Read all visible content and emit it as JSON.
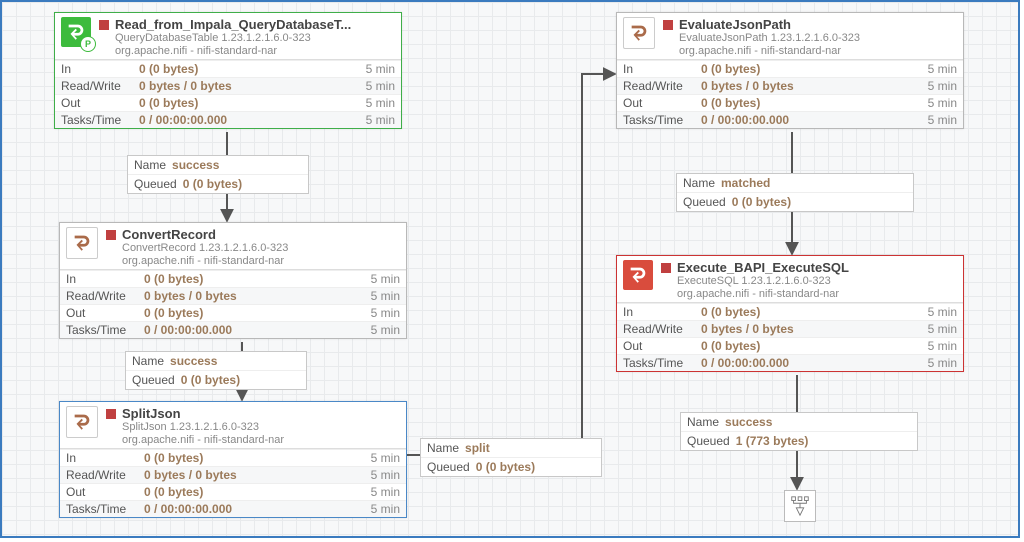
{
  "processors": {
    "read_impala": {
      "title": "Read_from_Impala_QueryDatabaseT...",
      "type_line": "QueryDatabaseTable 1.23.1.2.1.6.0-323",
      "bundle": "org.apache.nifi - nifi-standard-nar",
      "in_label": "In",
      "in_value": "0 (0 bytes)",
      "in_time": "5 min",
      "rw_label": "Read/Write",
      "rw_value": "0 bytes / 0 bytes",
      "rw_time": "5 min",
      "out_label": "Out",
      "out_value": "0 (0 bytes)",
      "out_time": "5 min",
      "tasks_label": "Tasks/Time",
      "tasks_value": "0 / 00:00:00.000",
      "tasks_time": "5 min"
    },
    "convert_record": {
      "title": "ConvertRecord",
      "type_line": "ConvertRecord 1.23.1.2.1.6.0-323",
      "bundle": "org.apache.nifi - nifi-standard-nar",
      "in_label": "In",
      "in_value": "0 (0 bytes)",
      "in_time": "5 min",
      "rw_label": "Read/Write",
      "rw_value": "0 bytes / 0 bytes",
      "rw_time": "5 min",
      "out_label": "Out",
      "out_value": "0 (0 bytes)",
      "out_time": "5 min",
      "tasks_label": "Tasks/Time",
      "tasks_value": "0 / 00:00:00.000",
      "tasks_time": "5 min"
    },
    "split_json": {
      "title": "SplitJson",
      "type_line": "SplitJson 1.23.1.2.1.6.0-323",
      "bundle": "org.apache.nifi - nifi-standard-nar",
      "in_label": "In",
      "in_value": "0 (0 bytes)",
      "in_time": "5 min",
      "rw_label": "Read/Write",
      "rw_value": "0 bytes / 0 bytes",
      "rw_time": "5 min",
      "out_label": "Out",
      "out_value": "0 (0 bytes)",
      "out_time": "5 min",
      "tasks_label": "Tasks/Time",
      "tasks_value": "0 / 00:00:00.000",
      "tasks_time": "5 min"
    },
    "eval_json": {
      "title": "EvaluateJsonPath",
      "type_line": "EvaluateJsonPath 1.23.1.2.1.6.0-323",
      "bundle": "org.apache.nifi - nifi-standard-nar",
      "in_label": "In",
      "in_value": "0 (0 bytes)",
      "in_time": "5 min",
      "rw_label": "Read/Write",
      "rw_value": "0 bytes / 0 bytes",
      "rw_time": "5 min",
      "out_label": "Out",
      "out_value": "0 (0 bytes)",
      "out_time": "5 min",
      "tasks_label": "Tasks/Time",
      "tasks_value": "0 / 00:00:00.000",
      "tasks_time": "5 min"
    },
    "execute_bapi": {
      "title": "Execute_BAPI_ExecuteSQL",
      "type_line": "ExecuteSQL 1.23.1.2.1.6.0-323",
      "bundle": "org.apache.nifi - nifi-standard-nar",
      "in_label": "In",
      "in_value": "0 (0 bytes)",
      "in_time": "5 min",
      "rw_label": "Read/Write",
      "rw_value": "0 bytes / 0 bytes",
      "rw_time": "5 min",
      "out_label": "Out",
      "out_value": "0 (0 bytes)",
      "out_time": "5 min",
      "tasks_label": "Tasks/Time",
      "tasks_value": "0 / 00:00:00.000",
      "tasks_time": "5 min"
    }
  },
  "connections": {
    "success_1": {
      "name_label": "Name",
      "name_value": "success",
      "q_label": "Queued",
      "q_value": "0 (0 bytes)"
    },
    "success_2": {
      "name_label": "Name",
      "name_value": "success",
      "q_label": "Queued",
      "q_value": "0 (0 bytes)"
    },
    "split": {
      "name_label": "Name",
      "name_value": "split",
      "q_label": "Queued",
      "q_value": "0 (0 bytes)"
    },
    "matched": {
      "name_label": "Name",
      "name_value": "matched",
      "q_label": "Queued",
      "q_value": "0 (0 bytes)"
    },
    "success_3": {
      "name_label": "Name",
      "name_value": "success",
      "q_label": "Queued",
      "q_value": "1 (773 bytes)"
    }
  }
}
